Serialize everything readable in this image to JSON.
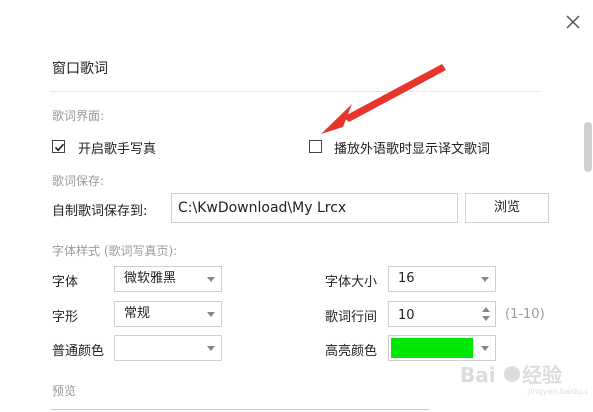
{
  "window": {
    "title": "窗口歌词"
  },
  "lyrics_ui": {
    "section_label": "歌词界面:",
    "show_singer_photo": {
      "label": "开启歌手写真",
      "checked": true
    },
    "show_translation": {
      "label": "播放外语歌时显示译文歌词",
      "checked": false
    }
  },
  "lyrics_save": {
    "section_label": "歌词保存:",
    "path_label": "自制歌词保存到:",
    "path_value": "C:\\KwDownload\\My Lrcx",
    "browse_label": "浏览"
  },
  "font_style": {
    "section_label": "字体样式 (歌词写真页):",
    "font_label": "字体",
    "font_value": "微软雅黑",
    "font_size_label": "字体大小",
    "font_size_value": "16",
    "font_shape_label": "字形",
    "font_shape_value": "常规",
    "line_spacing_label": "歌词行间",
    "line_spacing_value": "10",
    "line_spacing_range": "(1-10)",
    "normal_color_label": "普通颜色",
    "normal_color": "#ffffff",
    "highlight_color_label": "高亮颜色",
    "highlight_color": "#00e600"
  },
  "preview": {
    "section_label": "预览"
  },
  "colors": {
    "arrow": "#e8352b"
  }
}
